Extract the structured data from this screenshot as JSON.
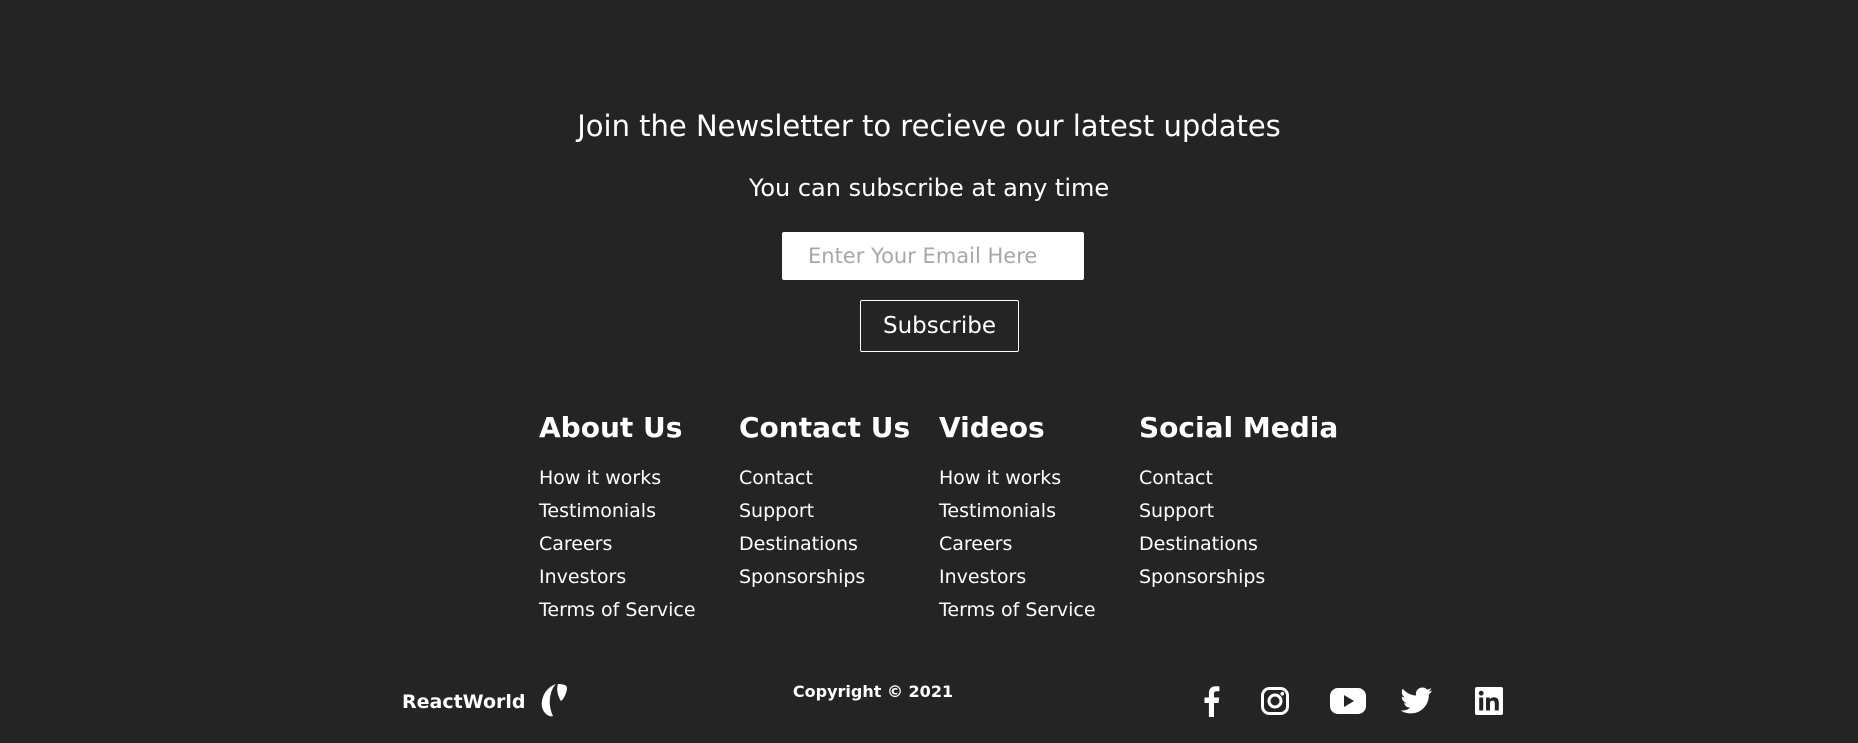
{
  "newsletter": {
    "heading": "Join the Newsletter to recieve our latest updates",
    "subheading": "You can subscribe at any time",
    "email_placeholder": "Enter Your Email Here",
    "subscribe_label": "Subscribe"
  },
  "columns": [
    {
      "title": "About Us",
      "links": [
        "How it works",
        "Testimonials",
        "Careers",
        "Investors",
        "Terms of Service"
      ]
    },
    {
      "title": "Contact Us",
      "links": [
        "Contact",
        "Support",
        "Destinations",
        "Sponsorships"
      ]
    },
    {
      "title": "Videos",
      "links": [
        "How it works",
        "Testimonials",
        "Careers",
        "Investors",
        "Terms of Service"
      ]
    },
    {
      "title": "Social Media",
      "links": [
        "Contact",
        "Support",
        "Destinations",
        "Sponsorships"
      ]
    }
  ],
  "footer": {
    "brand_name": "ReactWorld",
    "brand_icon": "typo3-icon",
    "copyright": "Copyright © 2021",
    "social_icons": [
      "facebook-icon",
      "instagram-icon",
      "youtube-icon",
      "twitter-icon",
      "linkedin-icon"
    ]
  },
  "colors": {
    "background": "#242424",
    "text": "#ffffff",
    "input_background": "#ffffff",
    "placeholder": "#a8a8a8"
  }
}
